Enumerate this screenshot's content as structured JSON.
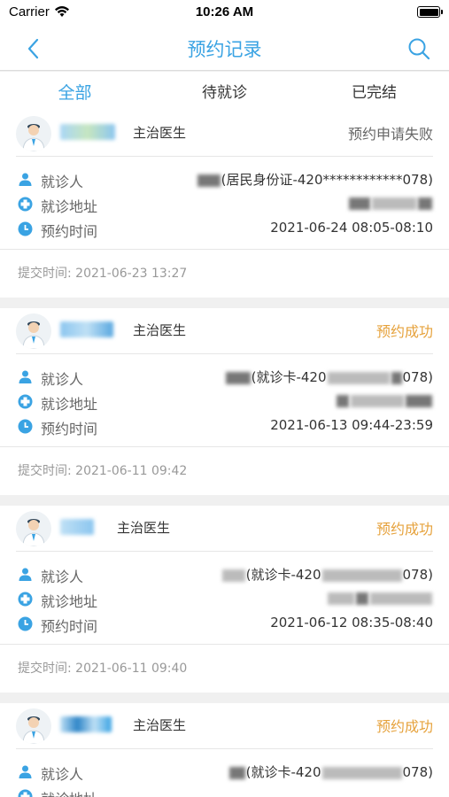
{
  "status_bar": {
    "carrier": "Carrier",
    "time": "10:26 AM"
  },
  "nav": {
    "title": "预约记录",
    "back_icon": "chevron-left-icon",
    "search_icon": "search-icon",
    "accent": "#3aa3e3"
  },
  "tabs": [
    {
      "label": "全部",
      "active": true
    },
    {
      "label": "待就诊",
      "active": false
    },
    {
      "label": "已完结",
      "active": false
    }
  ],
  "labels": {
    "patient": "就诊人",
    "address": "就诊地址",
    "time": "预约时间"
  },
  "records": [
    {
      "doctor_title": "主治医生",
      "status": "预约申请失败",
      "status_type": "fail",
      "patient_id": "(居民身份证-420************078)",
      "appt_time": "2021-06-24 08:05-08:10",
      "submit": "提交时间: 2021-06-23 13:27"
    },
    {
      "doctor_title": "主治医生",
      "status": "预约成功",
      "status_type": "ok",
      "patient_id_head": "(就诊卡-420",
      "patient_id_tail": "078)",
      "appt_time": "2021-06-13 09:44-23:59",
      "submit": "提交时间: 2021-06-11 09:42"
    },
    {
      "doctor_title": "主治医生",
      "status": "预约成功",
      "status_type": "ok",
      "patient_id_head": "(就诊卡-420",
      "patient_id_tail": "078)",
      "appt_time": "2021-06-12 08:35-08:40",
      "submit": "提交时间: 2021-06-11 09:40"
    },
    {
      "doctor_title": "主治医生",
      "status": "预约成功",
      "status_type": "ok",
      "patient_id_head": "(就诊卡-420",
      "patient_id_tail": "078)",
      "appt_time": "",
      "submit": ""
    }
  ],
  "colors": {
    "success": "#e6a23c",
    "fail": "#666666"
  }
}
